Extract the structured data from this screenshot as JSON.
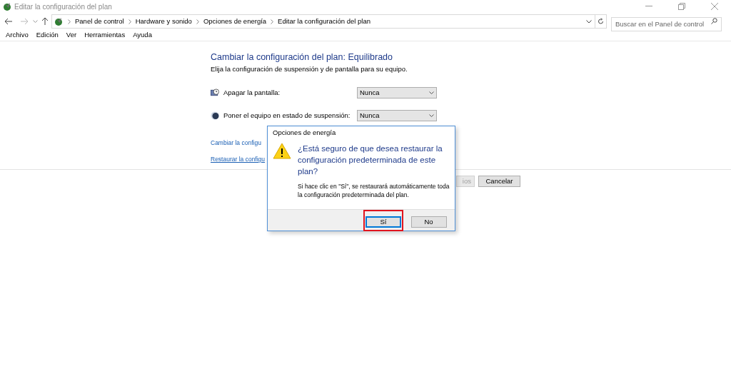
{
  "window": {
    "title": "Editar la configuración del plan"
  },
  "breadcrumb": [
    "Panel de control",
    "Hardware y sonido",
    "Opciones de energía",
    "Editar la configuración del plan"
  ],
  "search": {
    "placeholder": "Buscar en el Panel de control"
  },
  "menu": [
    "Archivo",
    "Edición",
    "Ver",
    "Herramientas",
    "Ayuda"
  ],
  "content": {
    "title": "Cambiar la configuración del plan: Equilibrado",
    "subtitle": "Elija la configuración de suspensión y de pantalla para su equipo.",
    "settings": [
      {
        "kind": "display",
        "label": "Apagar la pantalla:",
        "value": "Nunca"
      },
      {
        "kind": "sleep",
        "label": "Poner el equipo en estado de suspensión:",
        "value": "Nunca"
      }
    ],
    "links": [
      "Cambiar la configu",
      "Restaurar la configu"
    ],
    "buttons": [
      {
        "label": "ios",
        "disabled": true
      },
      {
        "label": "Cancelar",
        "disabled": false
      }
    ]
  },
  "dialog": {
    "title": "Opciones de energía",
    "question": "¿Está seguro de que desea restaurar la configuración predeterminada de este plan?",
    "message": "Si hace clic en \"Sí\", se restaurará automáticamente toda la configuración predeterminada del plan.",
    "buttons": [
      {
        "label": "Sí",
        "default": true,
        "highlighted": true
      },
      {
        "label": "No",
        "default": false,
        "highlighted": false
      }
    ]
  }
}
